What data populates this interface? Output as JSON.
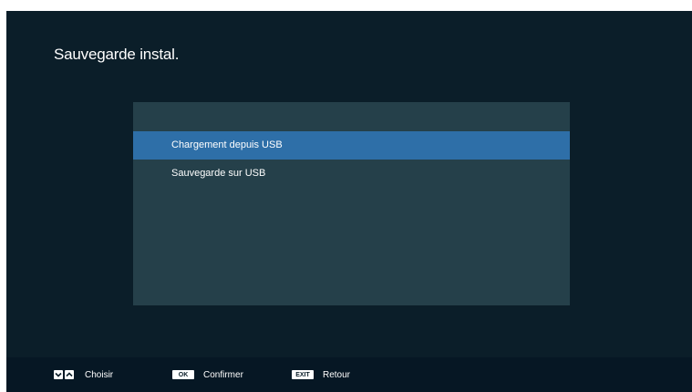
{
  "header": {
    "title": "Sauvegarde instal."
  },
  "menu": {
    "items": [
      {
        "label": "Chargement depuis USB",
        "selected": true
      },
      {
        "label": "Sauvegarde sur USB",
        "selected": false
      }
    ]
  },
  "footer": {
    "hints": [
      {
        "keys": [
          "chevron-down-icon",
          "chevron-up-icon"
        ],
        "label": "Choisir"
      },
      {
        "key_label": "OK",
        "label": "Confirmer"
      },
      {
        "key_label": "EXIT",
        "label": "Retour"
      }
    ]
  },
  "colors": {
    "background": "#0b1e29",
    "panel": "#25404a",
    "selection": "#2e6fa8",
    "footer": "#061724"
  }
}
